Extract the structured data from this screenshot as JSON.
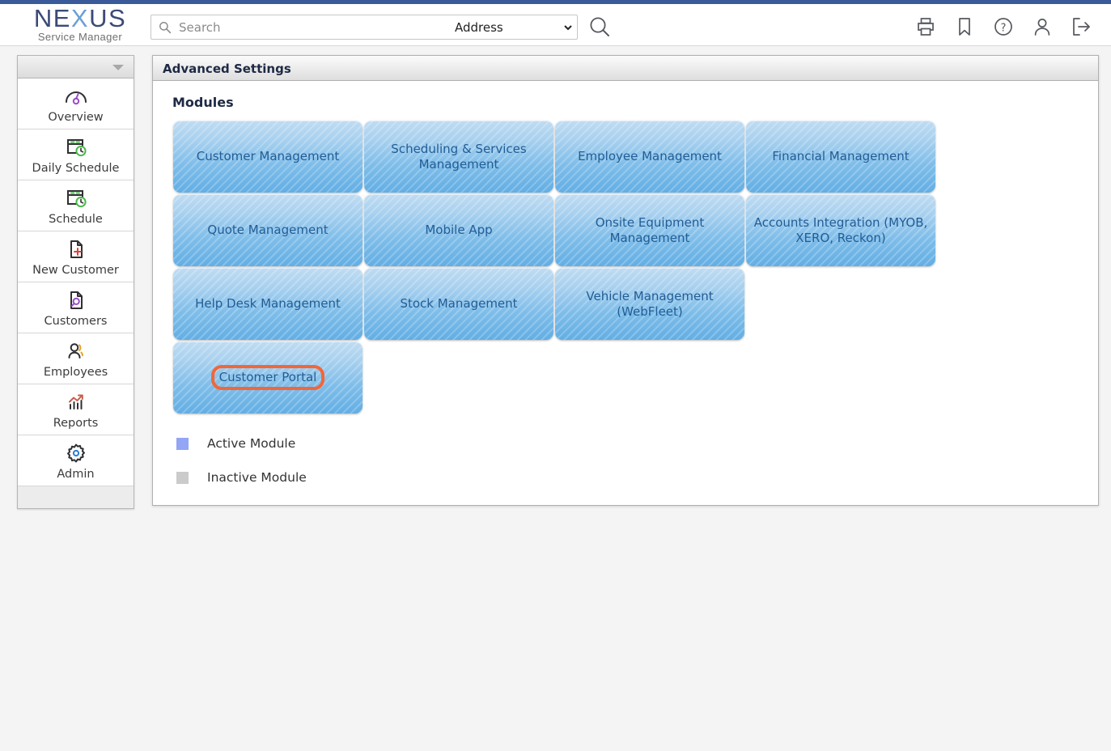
{
  "brand": {
    "name_part1": "NE",
    "name_x": "X",
    "name_part2": "US",
    "tagline": "Service Manager"
  },
  "search": {
    "placeholder": "Search",
    "value": "",
    "scope_selected": "Address",
    "scope_options": [
      "Address"
    ],
    "icon": "search-icon",
    "submit_icon": "search-submit-icon"
  },
  "header_icons": [
    {
      "name": "print-icon",
      "label": "Print"
    },
    {
      "name": "bookmark-icon",
      "label": "Bookmark"
    },
    {
      "name": "help-icon",
      "label": "Help"
    },
    {
      "name": "user-account-icon",
      "label": "Account"
    },
    {
      "name": "logout-icon",
      "label": "Log out"
    }
  ],
  "sidebar": {
    "collapse_icon": "chevron-down-icon",
    "items": [
      {
        "label": "Overview",
        "icon": "gauge-icon"
      },
      {
        "label": "Daily Schedule",
        "icon": "calendar-clock-icon"
      },
      {
        "label": "Schedule",
        "icon": "calendar-clock-icon"
      },
      {
        "label": "New Customer",
        "icon": "document-plus-icon"
      },
      {
        "label": "Customers",
        "icon": "document-search-icon"
      },
      {
        "label": "Employees",
        "icon": "people-icon"
      },
      {
        "label": "Reports",
        "icon": "bar-chart-arrow-icon"
      },
      {
        "label": "Admin",
        "icon": "gear-icon"
      }
    ]
  },
  "panel": {
    "title": "Advanced Settings",
    "section_title": "Modules"
  },
  "modules": [
    {
      "label": "Customer Management",
      "active": true,
      "highlighted": false
    },
    {
      "label": "Scheduling & Services Management",
      "active": true,
      "highlighted": false
    },
    {
      "label": "Employee Management",
      "active": true,
      "highlighted": false
    },
    {
      "label": "Financial Management",
      "active": true,
      "highlighted": false
    },
    {
      "label": "Quote Management",
      "active": true,
      "highlighted": false
    },
    {
      "label": "Mobile App",
      "active": true,
      "highlighted": false
    },
    {
      "label": "Onsite Equipment Management",
      "active": true,
      "highlighted": false
    },
    {
      "label": "Accounts Integration (MYOB, XERO, Reckon)",
      "active": true,
      "highlighted": false
    },
    {
      "label": "Help Desk Management",
      "active": true,
      "highlighted": false
    },
    {
      "label": "Stock Management",
      "active": true,
      "highlighted": false
    },
    {
      "label": "Vehicle Management (WebFleet)",
      "active": true,
      "highlighted": false
    },
    {
      "label": "Customer Portal",
      "active": true,
      "highlighted": true
    }
  ],
  "legend": [
    {
      "label": "Active Module",
      "color": "#93a5f5"
    },
    {
      "label": "Inactive Module",
      "color": "#cbcbcb"
    }
  ],
  "colors": {
    "top_strip": "#3a5a99",
    "tile_text": "#225d96",
    "highlight": "#f2663a",
    "page_background": "#f4f4f4"
  }
}
